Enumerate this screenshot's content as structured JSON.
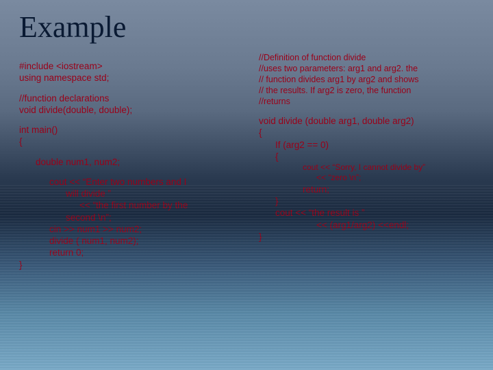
{
  "title": "Example",
  "left": {
    "l1": "#include <iostream>",
    "l2": "using namespace std;",
    "l3": "//function declarations",
    "l4": "void divide(double, double);",
    "l5": "int main()",
    "l6": "{",
    "l7": "double num1, num2;",
    "l8a": "cout << “Enter two numbers and I",
    "l8b": "will divide ”",
    "l8c": "<< “the first number by the",
    "l8d": "second \\n”;",
    "l9": "cin >> num1 >> num2;",
    "l10": "divide ( num1, num2);",
    "l11": "return 0;",
    "l12": "}"
  },
  "right": {
    "c1": "//Definition of function divide",
    "c2": "//uses two parameters: arg1 and arg2. the",
    "c3": "// function divides arg1 by arg2 and shows",
    "c4": "// the results. If arg2 is zero, the function",
    "c5": "//returns",
    "r1": "void divide (double arg1, double arg2)",
    "r2": "{",
    "r3": "If (arg2 == 0)",
    "r4": "{",
    "r5a": "cout << “Sorry, I cannot divide by”",
    "r5b": "<< “zero \\n”;",
    "r6": "return;",
    "r7": "}",
    "r8": "cout << “the result is ”",
    "r9": "<< (arg1/arg2) <<endl;",
    "r10": "}"
  }
}
